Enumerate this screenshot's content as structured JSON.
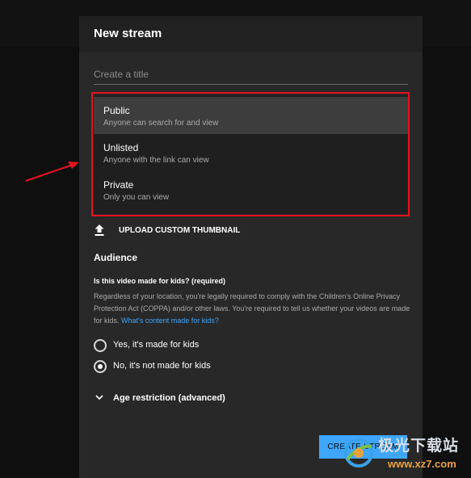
{
  "dialog": {
    "title": "New stream"
  },
  "title_field": {
    "placeholder": "Create a title",
    "value": ""
  },
  "visibility": {
    "selected": "Public",
    "options": [
      {
        "label": "Public",
        "description": "Anyone can search for and view"
      },
      {
        "label": "Unlisted",
        "description": "Anyone with the link can view"
      },
      {
        "label": "Private",
        "description": "Only you can view"
      }
    ]
  },
  "upload": {
    "label": "UPLOAD CUSTOM THUMBNAIL",
    "icon": "upload-icon"
  },
  "audience": {
    "heading": "Audience",
    "question": "Is this video made for kids? (required)",
    "body": "Regardless of your location, you're legally required to comply with the Children's Online Privacy Protection Act (COPPA) and/or other laws. You're required to tell us whether your videos are made for kids.",
    "link": "What's content made for kids?",
    "options": [
      {
        "label": "Yes, it's made for kids",
        "checked": false
      },
      {
        "label": "No, it's not made for kids",
        "checked": true
      }
    ]
  },
  "age_restriction": {
    "label": "Age restriction (advanced)",
    "icon": "chevron-down-icon"
  },
  "actions": {
    "create_label": "CREATE STREAM"
  },
  "annotation": {
    "highlight_color": "#e3131f",
    "arrow_color": "#e3131f"
  },
  "watermark": {
    "text": "极光下载站",
    "url": "www.xz7.com"
  },
  "colors": {
    "accent": "#3ea6ff",
    "dialog_bg": "#282828",
    "header_bg": "#212121"
  }
}
